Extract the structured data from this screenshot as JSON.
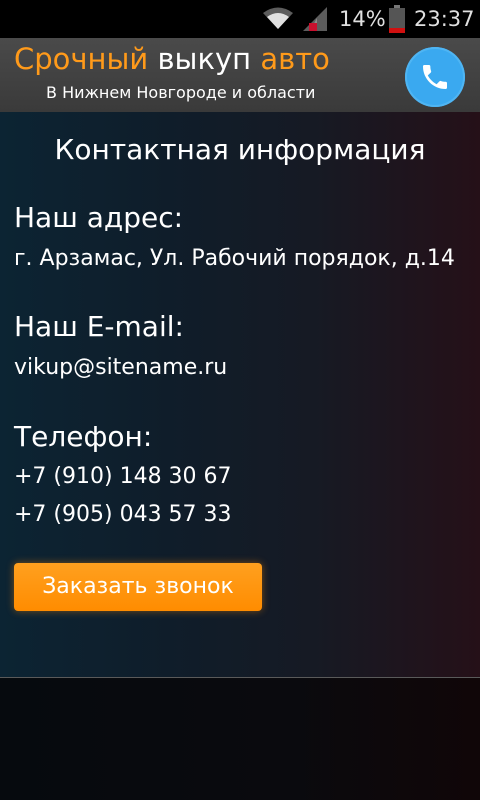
{
  "status_bar": {
    "battery_percent": "14%",
    "time": "23:37"
  },
  "header": {
    "title_part1": "Срочный",
    "title_part2": "выкуп",
    "title_part3": "авто",
    "subtitle": "В Нижнем Новгороде и области",
    "accent_color": "#ff9a1a",
    "call_button_color": "#3aa9f0",
    "call_icon": "phone-icon"
  },
  "contact": {
    "heading": "Контактная информация",
    "address_label": "Наш адрес:",
    "address_value": "г. Арзамас, Ул. Рабочий порядок, д.14",
    "email_label": "Наш E-mail:",
    "email_value": "vikup@sitename.ru",
    "phone_label": "Телефон:",
    "phones": [
      "+7 (910) 148 30 67",
      "+7 (905) 043 57 33"
    ]
  },
  "order_button": {
    "label": "Заказать звонок",
    "color": "#ff9000"
  }
}
